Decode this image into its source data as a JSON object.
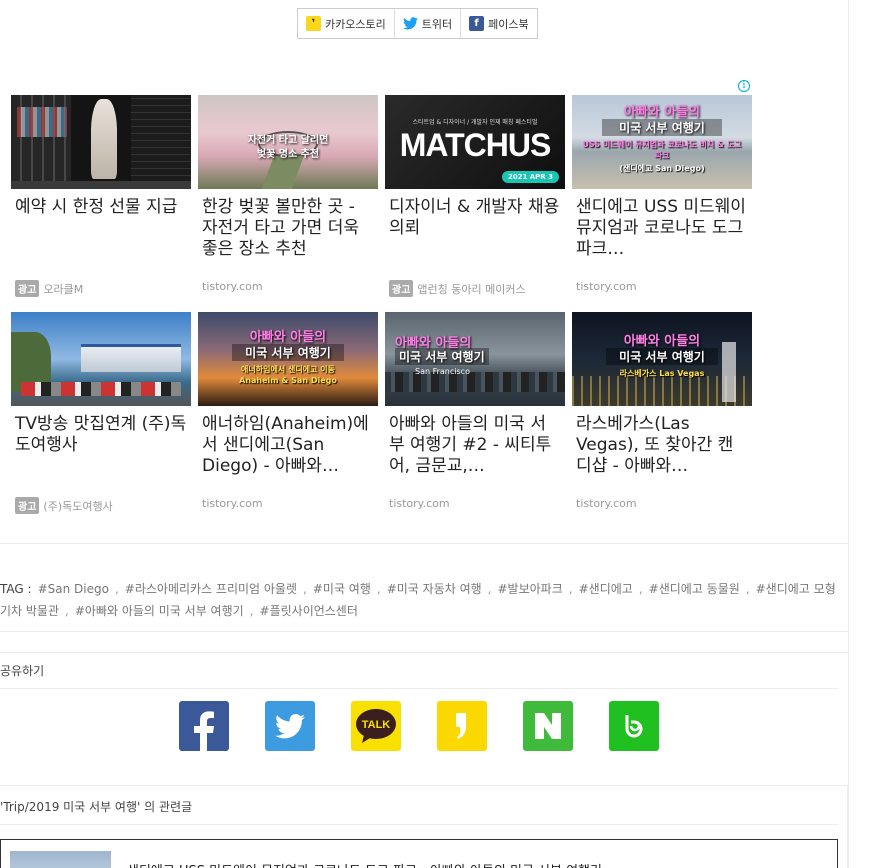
{
  "share_bar": [
    {
      "label": "카카오스토리",
      "icon": "kakaostory-icon"
    },
    {
      "label": "트위터",
      "icon": "twitter-icon"
    },
    {
      "label": "페이스북",
      "icon": "facebook-icon"
    }
  ],
  "ads": [
    {
      "title": "예약 시 한정 선물 지급",
      "badge": "광고",
      "source": "오라클M",
      "thumb": {
        "kind": "game"
      }
    },
    {
      "title": "한강 벚꽃 볼만한 곳 - 자전거 타고 가면 더욱 좋은 장소 추천",
      "badge": "",
      "source": "tistory.com",
      "thumb": {
        "kind": "cherry",
        "line1": "자전거 타고 달리면",
        "line2": "벚꽃 명소 추천"
      }
    },
    {
      "title": "디자이너 & 개발자 채용 의뢰",
      "badge": "광고",
      "source": "앱런칭 동아리 메이커스",
      "thumb": {
        "kind": "matchus",
        "small": "스타트업 & 디자이너 / 개발자 인재 매칭 페스티벌",
        "big": "MATCHUS",
        "date": "2021 APR 3"
      }
    },
    {
      "title": "샌디에고 USS 미드웨이 뮤지엄과 코로나도 도그 파크…",
      "badge": "",
      "source": "tistory.com",
      "thumb": {
        "kind": "beach",
        "line1": "아빠와 아들의",
        "line2": "미국 서부 여행기",
        "line3": "USS 미드웨이 뮤지엄과 코로나도 비치 & 도그 파크",
        "line4": "(샌디에고 San Diego)"
      }
    },
    {
      "title": "TV방송 맛집연계 (주)독도여행사",
      "badge": "광고",
      "source": "(주)독도여행사",
      "thumb": {
        "kind": "harbor"
      }
    },
    {
      "title": "애너하임(Anaheim)에서 샌디에고(San Diego) - 아빠와…",
      "badge": "",
      "source": "tistory.com",
      "thumb": {
        "kind": "sunset",
        "line1": "아빠와 아들의",
        "line2": "미국 서부 여행기",
        "line3": "애너하임에서 샌디에고 이동",
        "line4": "Anaheim & San Diego"
      }
    },
    {
      "title": "아빠와 아들의 미국 서부 여행기 #2 - 씨티투어, 금문교,…",
      "badge": "",
      "source": "tistory.com",
      "thumb": {
        "kind": "city",
        "line1": "아빠와 아들의",
        "line2": "미국 서부 여행기",
        "line3": "San Francisco"
      }
    },
    {
      "title": "라스베가스(Las Vegas), 또 찾아간 캔디샵 - 아빠와…",
      "badge": "",
      "source": "tistory.com",
      "thumb": {
        "kind": "vegas",
        "line1": "아빠와 아들의",
        "line2": "미국 서부 여행기",
        "line3": "라스베가스 Las Vegas"
      }
    }
  ],
  "tags": {
    "label": "TAG :",
    "items": [
      "#San Diego",
      "#라스아메리카스 프리미엄 아울렛",
      "#미국 여행",
      "#미국 자동차 여행",
      "#발보아파크",
      "#샌디에고",
      "#샌디에고 동물원",
      "#샌디에고 모형기차 박물관",
      "#아빠와 아들의 미국 서부 여행기",
      "#플릿사이언스센터"
    ]
  },
  "share_section": {
    "title": "공유하기",
    "icons": [
      {
        "name": "facebook-share-icon",
        "color": "#3b5998"
      },
      {
        "name": "twitter-share-icon",
        "color": "#3d9be0"
      },
      {
        "name": "kakaotalk-share-icon",
        "color": "#f9e000"
      },
      {
        "name": "kakaostory-share-icon",
        "color": "#fbd800"
      },
      {
        "name": "naver-share-icon",
        "color": "#3fba3a"
      },
      {
        "name": "band-share-icon",
        "color": "#20c020"
      }
    ]
  },
  "related": {
    "title": "'Trip/2019 미국 서부 여행' 의 관련글",
    "first_item": "샌디에고 USS 미드웨이 뮤지엄과 코로나도 도그 파크 - 아빠와 아들의 미국 서부 여행기"
  },
  "colors": {
    "ad_info": "#00aecd",
    "pink_overlay": "#ff7ee6",
    "divider": "#ececec"
  }
}
